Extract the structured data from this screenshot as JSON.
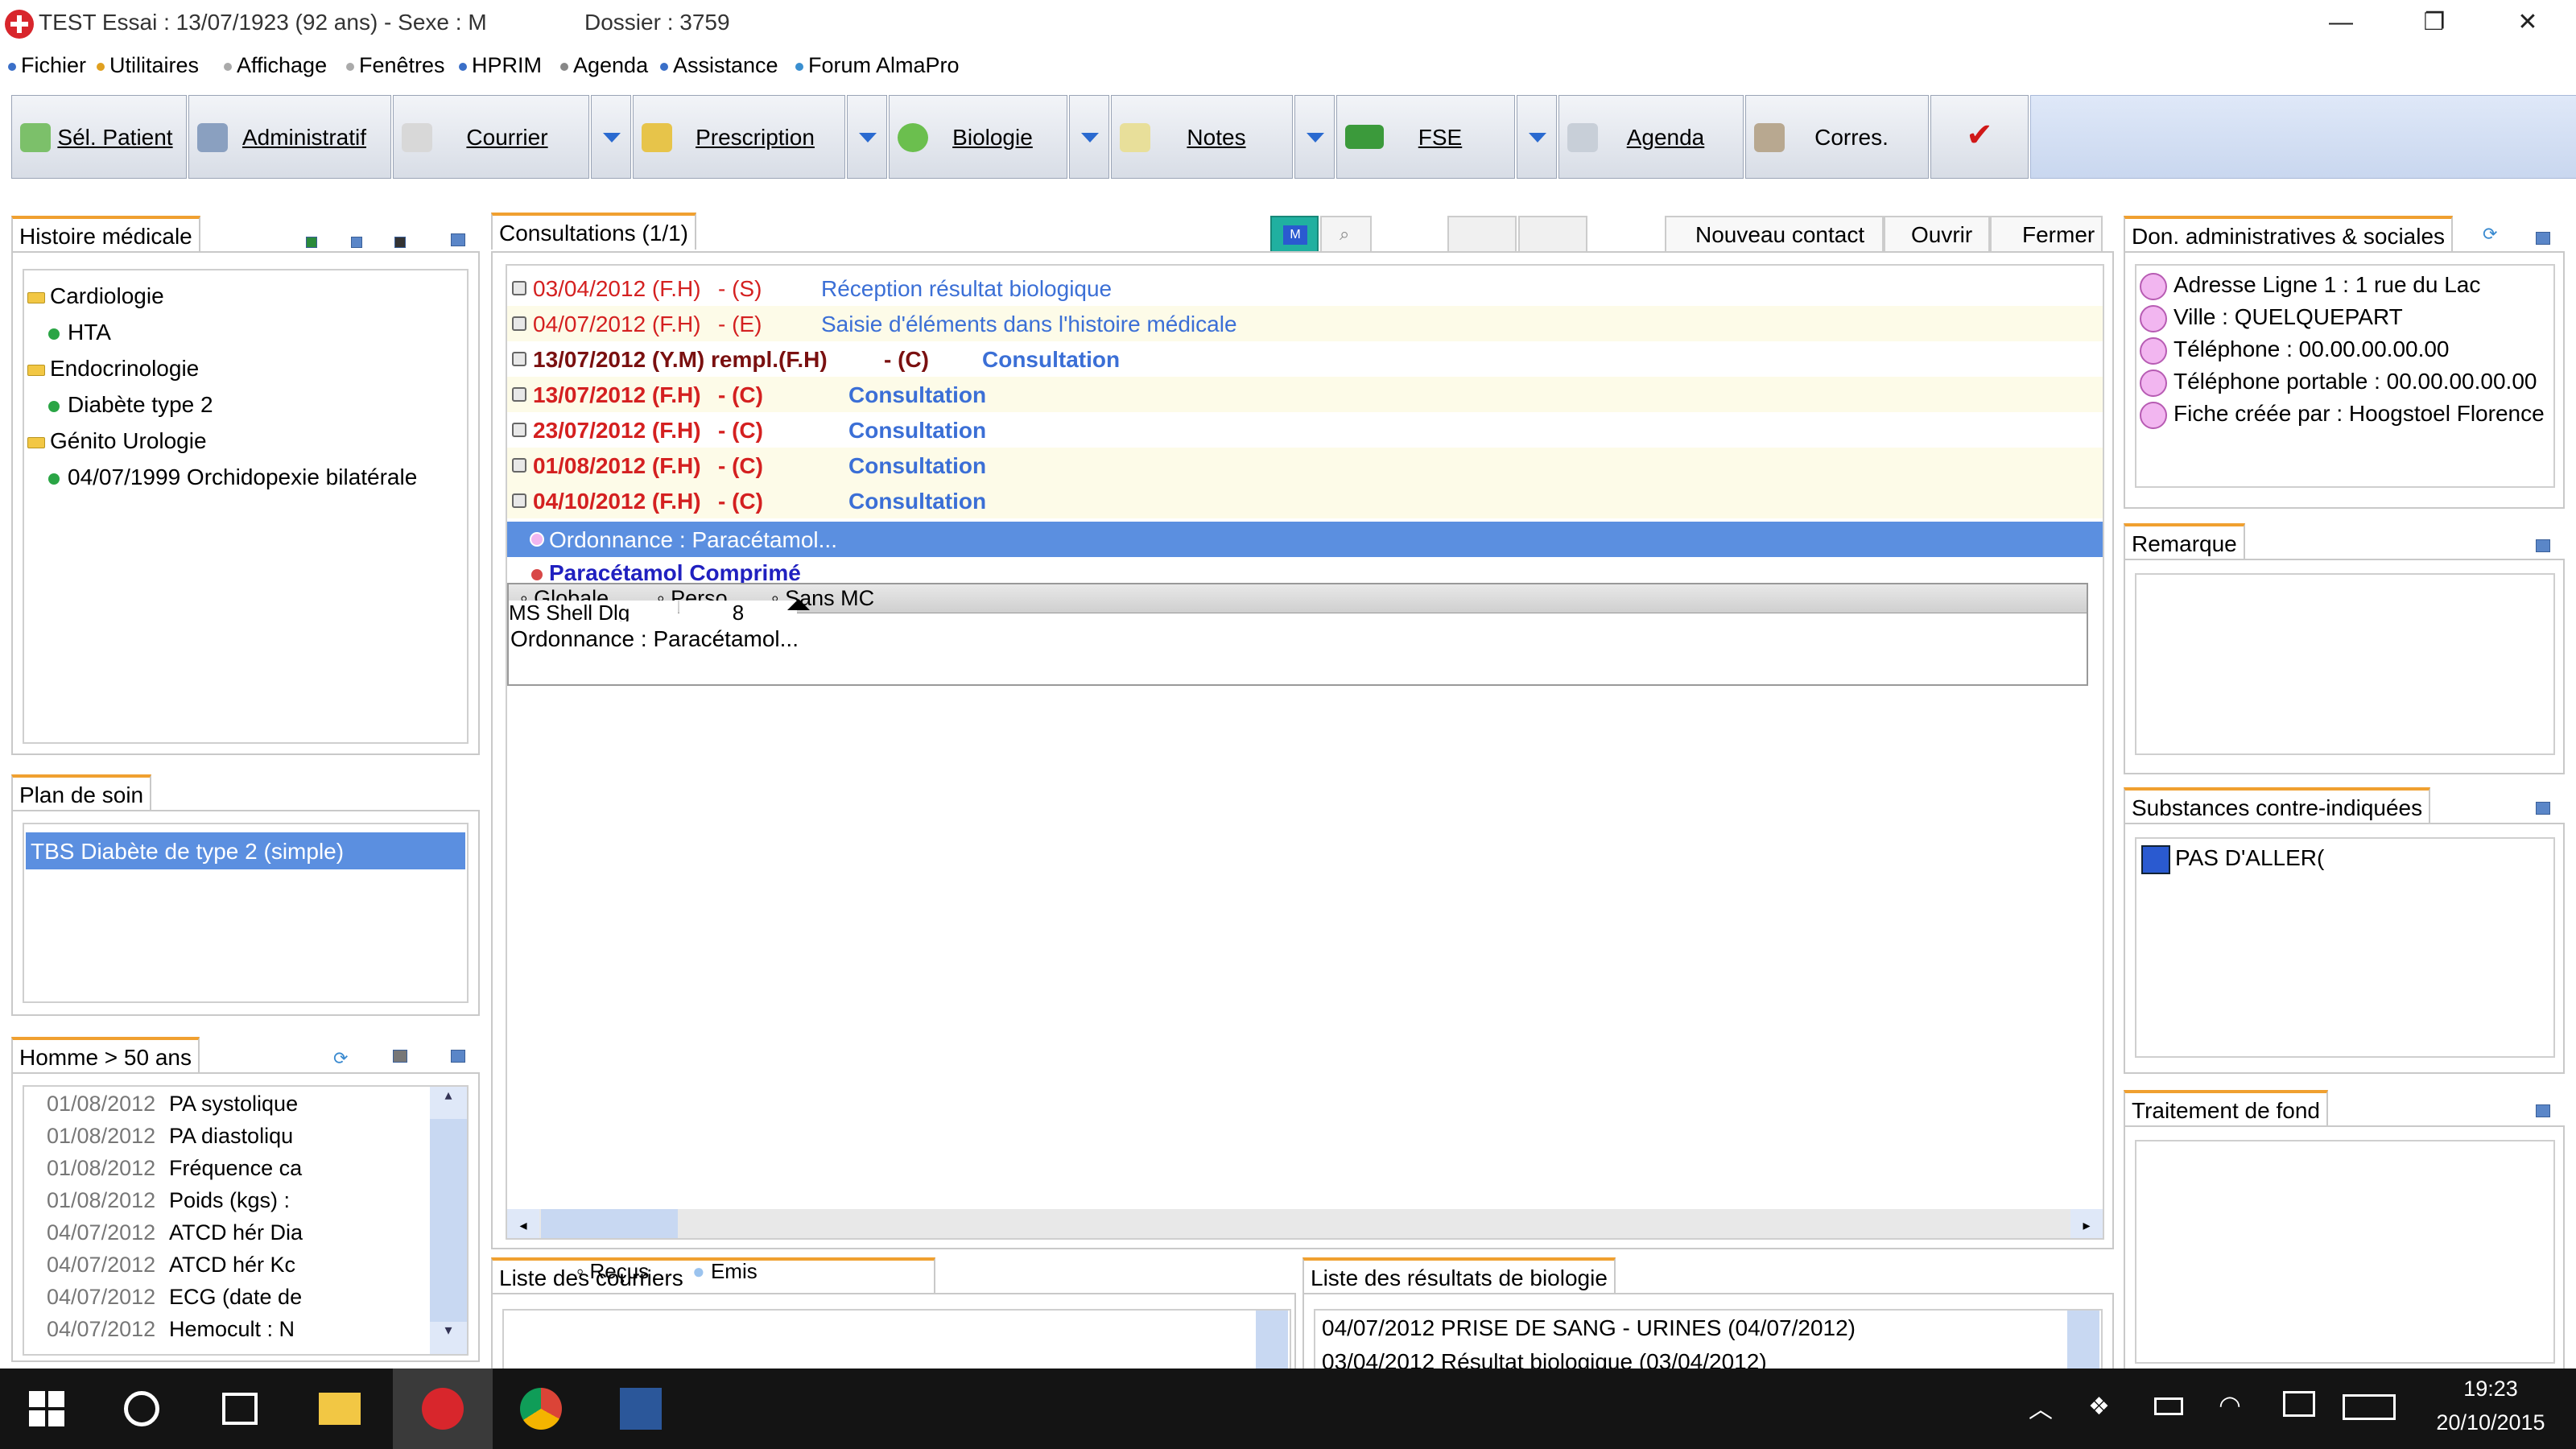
{
  "window": {
    "title": "TEST Essai : 13/07/1923 (92 ans)  - Sexe : M",
    "dossier": "Dossier : 3759",
    "controls": {
      "minimize": "—",
      "maximize": "❐",
      "close": "✕"
    }
  },
  "menu": [
    "Fichier",
    "Utilitaires",
    "Affichage",
    "Fenêtres",
    "HPRIM",
    "Agenda",
    "Assistance",
    "Forum AlmaPro"
  ],
  "toolbar": {
    "sel_patient": "Sél. Patient",
    "administratif": "Administratif",
    "courrier": "Courrier",
    "prescription": "Prescription",
    "biologie": "Biologie",
    "notes": "Notes",
    "fse": "FSE",
    "agenda": "Agenda",
    "corres": "Corres.",
    "validate_icon": "✔"
  },
  "histoire": {
    "title": "Histoire médicale",
    "tree": [
      {
        "label": "Cardiologie",
        "children": [
          "HTA"
        ]
      },
      {
        "label": "Endocrinologie",
        "children": [
          "Diabète type 2"
        ]
      },
      {
        "label": "Génito Urologie",
        "children": [
          "04/07/1999 Orchidopexie bilatérale"
        ]
      }
    ]
  },
  "plan": {
    "title": "Plan de soin",
    "selected": "TBS Diabète de type 2 (simple)"
  },
  "homme": {
    "title": "Homme > 50 ans",
    "rows": [
      {
        "date": "01/08/2012",
        "text": "PA systolique"
      },
      {
        "date": "01/08/2012",
        "text": "PA diastoliqu"
      },
      {
        "date": "01/08/2012",
        "text": "Fréquence ca"
      },
      {
        "date": "01/08/2012",
        "text": "Poids (kgs) : "
      },
      {
        "date": "04/07/2012",
        "text": "ATCD hér Dia"
      },
      {
        "date": "04/07/2012",
        "text": "ATCD hér Kc"
      },
      {
        "date": "04/07/2012",
        "text": "ECG (date de"
      },
      {
        "date": "04/07/2012",
        "text": "Hemocult : N"
      }
    ]
  },
  "consultations": {
    "title": "Consultations (1/1)",
    "m_label": "M",
    "nouveau_contact": "Nouveau contact",
    "ouvrir": "Ouvrir",
    "fermer": "Fermer",
    "rows": [
      {
        "date": "03/04/2012 (F.H)",
        "type": "- (S)",
        "desc": "Réception résultat biologique",
        "bold": false
      },
      {
        "date": "04/07/2012 (F.H)",
        "type": "- (E)",
        "desc": "Saisie d'éléments dans l'histoire médicale",
        "bold": false
      },
      {
        "date": "13/07/2012 (Y.M) rempl.(F.H)",
        "type": "- (C)",
        "desc": "Consultation",
        "bold": true
      },
      {
        "date": "13/07/2012 (F.H)",
        "type": "- (C)",
        "desc": "Consultation",
        "bold": true
      },
      {
        "date": "23/07/2012 (F.H)",
        "type": "- (C)",
        "desc": "Consultation",
        "bold": true
      },
      {
        "date": "01/08/2012 (F.H)",
        "type": "- (C)",
        "desc": "Consultation",
        "bold": true
      },
      {
        "date": "04/10/2012 (F.H)",
        "type": "- (C)",
        "desc": "Consultation",
        "bold": true
      }
    ],
    "selected_row": "Ordonnance : Paracétamol...",
    "sub_item": "Paracétamol Comprimé",
    "editor": {
      "radio_options": [
        "Globale",
        "Perso",
        "Sans MC"
      ],
      "font_name": "MS Shell Dlg",
      "font_size": "8",
      "content": "Ordonnance : Paracétamol..."
    }
  },
  "courriers": {
    "title": "Liste des courriers",
    "options": [
      "Reçus",
      "Emis"
    ]
  },
  "biologie_list": {
    "title": "Liste des résultats de biologie",
    "rows": [
      "04/07/2012 PRISE DE SANG - URINES (04/07/2012)",
      "03/04/2012 Résultat biologique (03/04/2012)"
    ]
  },
  "admin": {
    "title": "Don. administratives & sociales",
    "rows": [
      "Adresse Ligne 1 : 1 rue du Lac",
      "Ville : QUELQUEPART",
      "Téléphone : 00.00.00.00.00",
      "Téléphone portable : 00.00.00.00.00",
      "Fiche créée par : Hoogstoel Florence"
    ]
  },
  "remarque": {
    "title": "Remarque"
  },
  "substances": {
    "title": "Substances contre-indiquées",
    "item": "PAS D'ALLER("
  },
  "traitement": {
    "title": "Traitement de fond"
  },
  "taskbar": {
    "time": "19:23",
    "date": "20/10/2015"
  },
  "colors": {
    "accent_blue": "#3b6fd6",
    "selection_blue": "#5b8fe0",
    "date_red": "#d42020",
    "tab_orange": "#f0a030",
    "row_alt": "#fdfbe8"
  }
}
